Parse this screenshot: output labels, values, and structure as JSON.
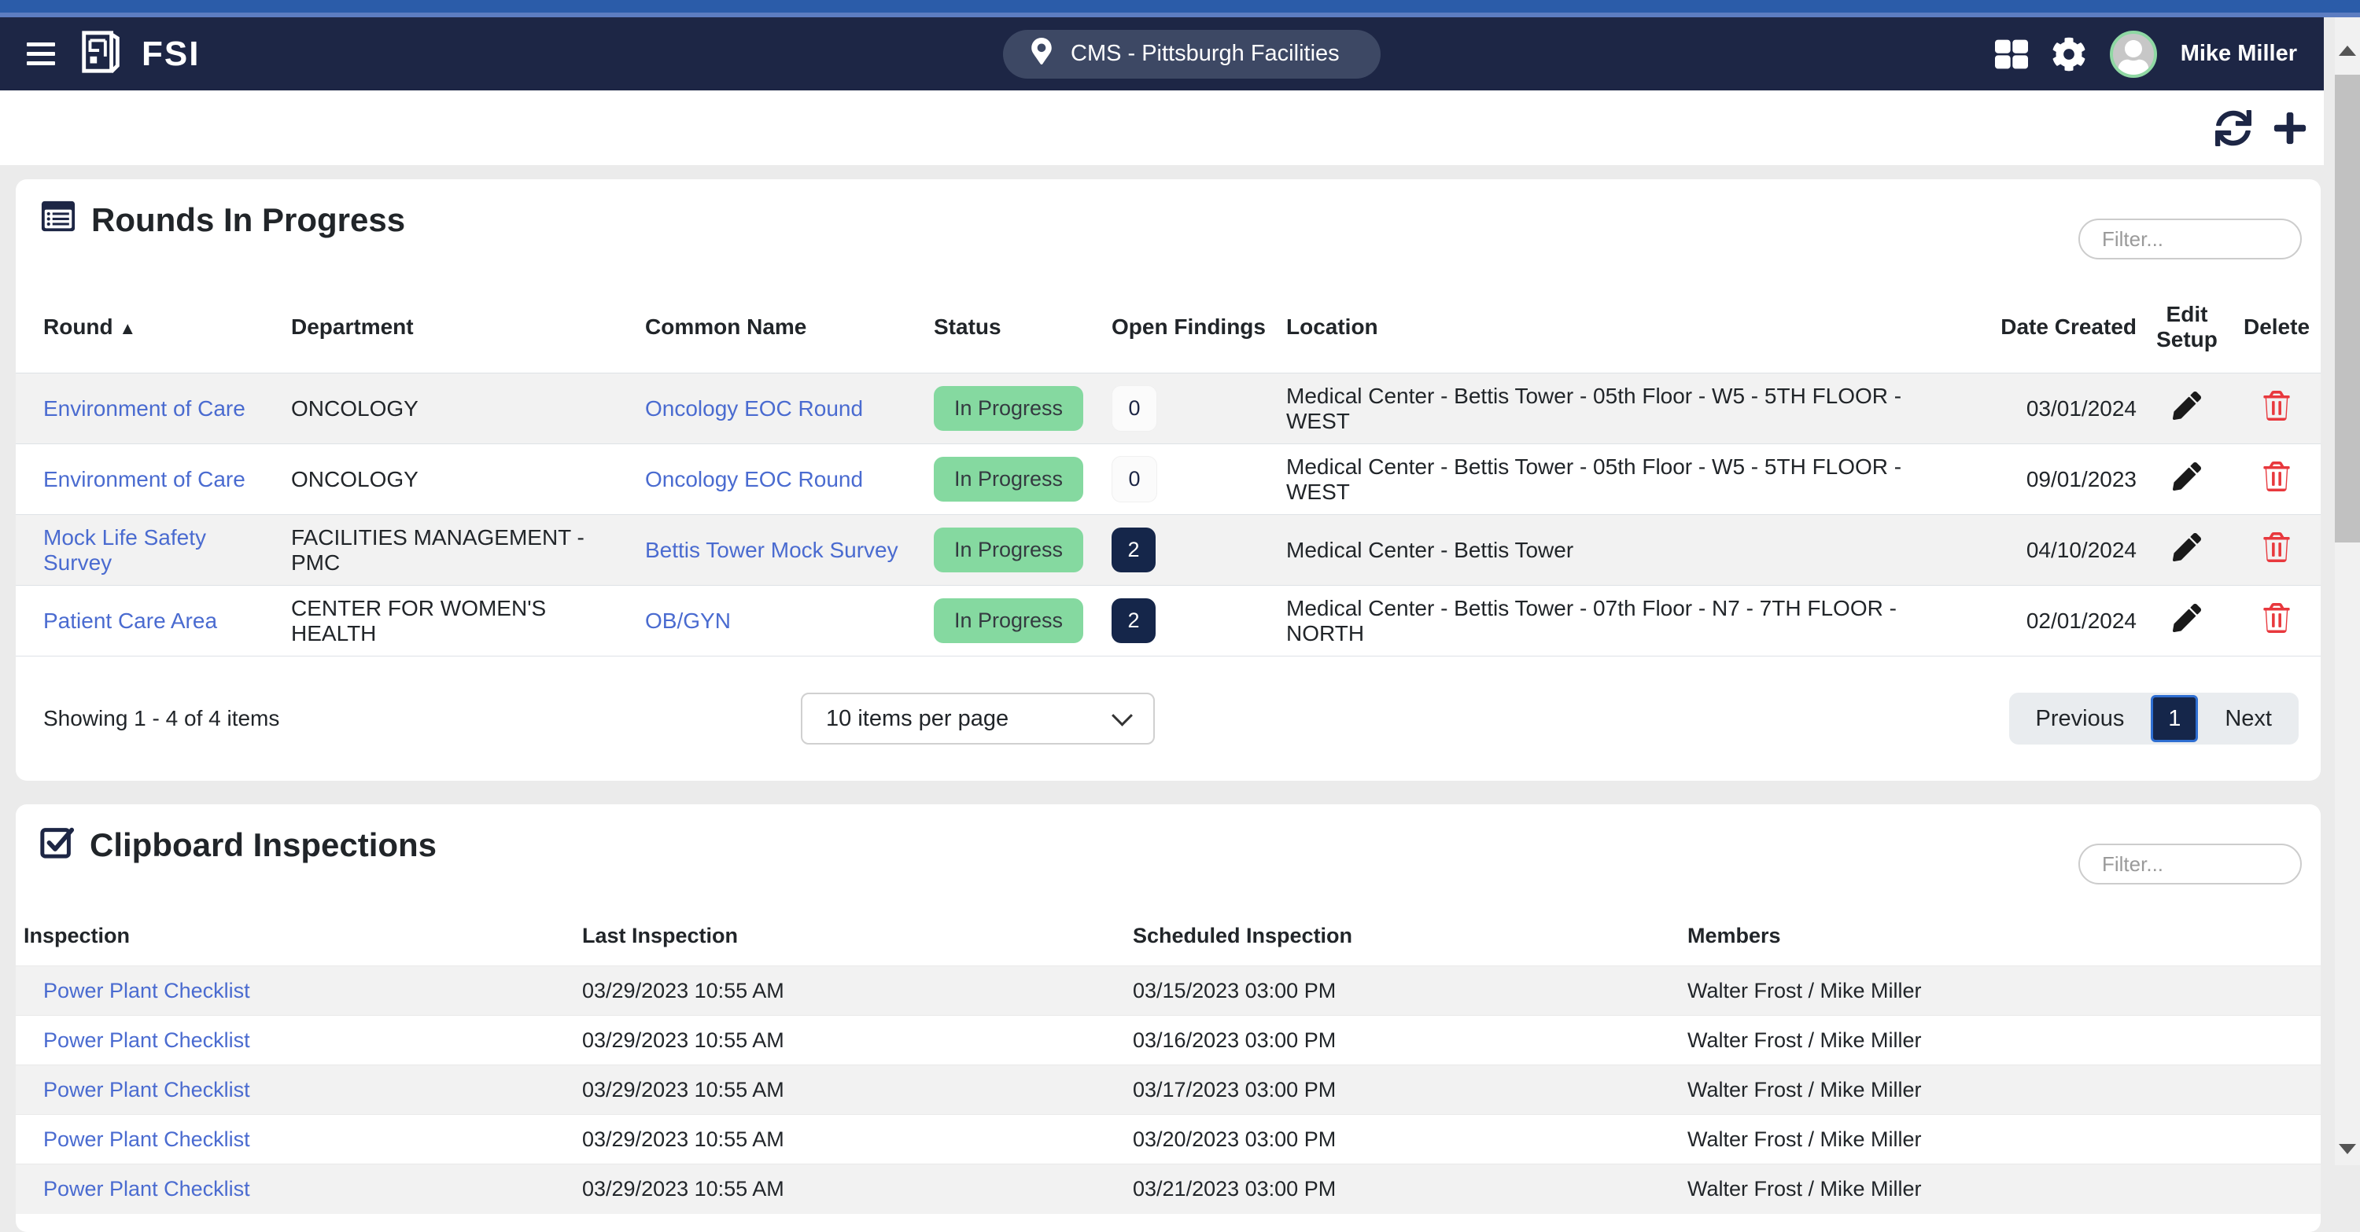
{
  "navbar": {
    "brand": "FSI",
    "location_pill": "CMS - Pittsburgh Facilities",
    "user_name": "Mike Miller"
  },
  "icons": {
    "menu": "hamburger-icon",
    "brand_logo": "fsi-document-logo",
    "location": "map-pin-icon",
    "apps": "grid-icon",
    "settings": "gear-icon",
    "user": "person-avatar-icon",
    "refresh": "sync-arrows-icon",
    "add": "plus-icon",
    "rounds_section": "list-panel-icon",
    "clipboard_section": "checked-checkbox-icon",
    "edit": "pencil-icon",
    "delete": "trash-icon",
    "sort_ascending": "▲",
    "select_chevron": "chevron-down"
  },
  "colors": {
    "navbar_navy": "#1d2645",
    "top_strip_blue": "#2b5ca9",
    "link_blue": "#4a6bd0",
    "status_green": "#85d9a0",
    "findings_navy": "#15264a",
    "delete_red": "#e8383d",
    "row_stripe": "#f2f2f2",
    "avatar_ring_green": "#8fd8a3"
  },
  "rounds": {
    "title": "Rounds In Progress",
    "filter_placeholder": "Filter...",
    "sort_indicator": "▲",
    "columns": [
      "Round",
      "Department",
      "Common Name",
      "Status",
      "Open Findings",
      "Location",
      "Date Created",
      "Edit Setup",
      "Delete"
    ],
    "rows": [
      {
        "round": "Environment of Care",
        "department": "ONCOLOGY",
        "common_name": "Oncology EOC Round",
        "status": "In Progress",
        "open_findings": "0",
        "location": "Medical Center - Bettis Tower - 05th Floor - W5 - 5TH FLOOR - WEST",
        "date_created": "03/01/2024"
      },
      {
        "round": "Environment of Care",
        "department": "ONCOLOGY",
        "common_name": "Oncology EOC Round",
        "status": "In Progress",
        "open_findings": "0",
        "location": "Medical Center - Bettis Tower - 05th Floor - W5 - 5TH FLOOR - WEST",
        "date_created": "09/01/2023"
      },
      {
        "round": "Mock Life Safety Survey",
        "department": "FACILITIES MANAGEMENT - PMC",
        "common_name": "Bettis Tower Mock Survey",
        "status": "In Progress",
        "open_findings": "2",
        "location": "Medical Center - Bettis Tower",
        "date_created": "04/10/2024"
      },
      {
        "round": "Patient Care Area",
        "department": "CENTER FOR WOMEN'S HEALTH",
        "common_name": "OB/GYN",
        "status": "In Progress",
        "open_findings": "2",
        "location": "Medical Center - Bettis Tower - 07th Floor - N7 - 7TH FLOOR - NORTH",
        "date_created": "02/01/2024"
      }
    ],
    "summary": "Showing 1 - 4 of 4 items",
    "page_size": "10 items per page",
    "pagination": {
      "previous": "Previous",
      "current": "1",
      "next": "Next"
    }
  },
  "clipboard": {
    "title": "Clipboard Inspections",
    "filter_placeholder": "Filter...",
    "columns": [
      "Inspection",
      "Last Inspection",
      "Scheduled Inspection",
      "Members"
    ],
    "rows": [
      {
        "inspection": "Power Plant Checklist",
        "last_inspection": "03/29/2023 10:55 AM",
        "scheduled_inspection": "03/15/2023 03:00 PM",
        "members": "Walter Frost / Mike Miller"
      },
      {
        "inspection": "Power Plant Checklist",
        "last_inspection": "03/29/2023 10:55 AM",
        "scheduled_inspection": "03/16/2023 03:00 PM",
        "members": "Walter Frost / Mike Miller"
      },
      {
        "inspection": "Power Plant Checklist",
        "last_inspection": "03/29/2023 10:55 AM",
        "scheduled_inspection": "03/17/2023 03:00 PM",
        "members": "Walter Frost / Mike Miller"
      },
      {
        "inspection": "Power Plant Checklist",
        "last_inspection": "03/29/2023 10:55 AM",
        "scheduled_inspection": "03/20/2023 03:00 PM",
        "members": "Walter Frost / Mike Miller"
      },
      {
        "inspection": "Power Plant Checklist",
        "last_inspection": "03/29/2023 10:55 AM",
        "scheduled_inspection": "03/21/2023 03:00 PM",
        "members": "Walter Frost / Mike Miller"
      }
    ]
  }
}
